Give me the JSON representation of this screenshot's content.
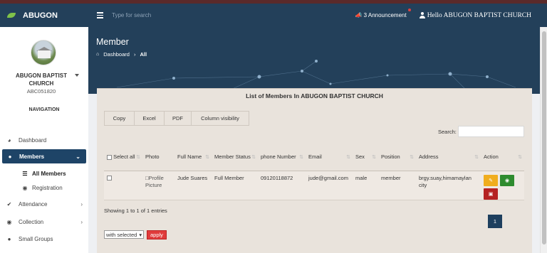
{
  "app": {
    "brand": "ABUGON"
  },
  "topbar": {
    "search_placeholder": "Type for search",
    "announcement": "3 Announcement",
    "greeting": "Hello ABUGON BAPTIST CHURCH"
  },
  "sidebar": {
    "church_name": "ABUGON BAPTIST CHURCH",
    "church_code": "ABC051820",
    "nav_heading": "NAVIGATION",
    "items": [
      {
        "label": "Dashboard",
        "icon": "tachometer-icon"
      },
      {
        "label": "Members",
        "icon": "users-icon",
        "active": true
      },
      {
        "label": "All Members",
        "icon": "list-icon",
        "sub": true,
        "active": true
      },
      {
        "label": "Registration",
        "icon": "circle-dot-icon",
        "sub": true
      },
      {
        "label": "Attendance",
        "icon": "check-icon"
      },
      {
        "label": "Collection",
        "icon": "coins-icon"
      },
      {
        "label": "Small Groups",
        "icon": "group-icon"
      }
    ]
  },
  "header": {
    "title": "Member",
    "breadcrumb_home": "Dashboard",
    "breadcrumb_current": "All"
  },
  "card": {
    "title": "List of Members In ABUGON BAPTIST CHURCH",
    "buttons": [
      "Copy",
      "Excel",
      "PDF",
      "Column visibility"
    ],
    "search_label": "Search:",
    "columns": [
      "Select all",
      "Photo",
      "Full Name",
      "Member Status",
      "phone Number",
      "Email",
      "Sex",
      "Position",
      "Address",
      "Action"
    ],
    "rows": [
      {
        "photo_alt": "Profile Picture",
        "full_name": "Jude Suares",
        "member_status": "Full Member",
        "phone": "09120118872",
        "email": "jude@gmail.com",
        "sex": "male",
        "position": "member",
        "address": "brgy.suay,himamaylan city"
      }
    ],
    "info": "Showing 1 to 1 of 1 entries",
    "page": "1",
    "bulk_select": "with selected",
    "apply": "apply"
  },
  "colors": {
    "navy": "#23405a",
    "active_nav": "#1e4467",
    "edit": "#f0ad1e",
    "view": "#2e8b2e",
    "delete": "#b52222",
    "apply": "#e03c3c"
  }
}
